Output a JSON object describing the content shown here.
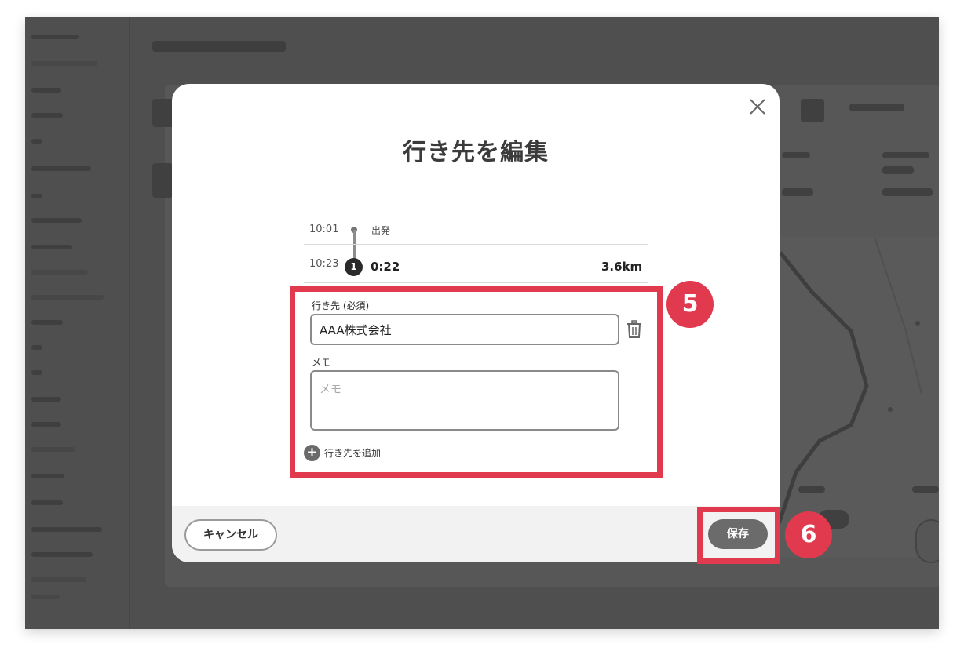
{
  "modal": {
    "title": "行き先を編集",
    "timeline": {
      "depart_time": "10:01",
      "depart_label": "出発",
      "arrive_time": "10:23",
      "stop_number": "1",
      "duration": "0:22",
      "distance": "3.6km"
    },
    "destination_label": "行き先 (必須)",
    "destination_value": "AAA株式会社",
    "memo_label": "メモ",
    "memo_placeholder": "メモ",
    "add_destination_label": "行き先を追加",
    "cancel_label": "キャンセル",
    "save_label": "保存"
  },
  "annotations": {
    "step5": "5",
    "step6": "6"
  },
  "colors": {
    "highlight": "#e13a4f",
    "overlay": "#4f4f4f",
    "save_button": "#6b6b6b"
  },
  "icons": {
    "close": "close-icon",
    "trash": "trash-icon",
    "add": "plus-circle-icon"
  }
}
